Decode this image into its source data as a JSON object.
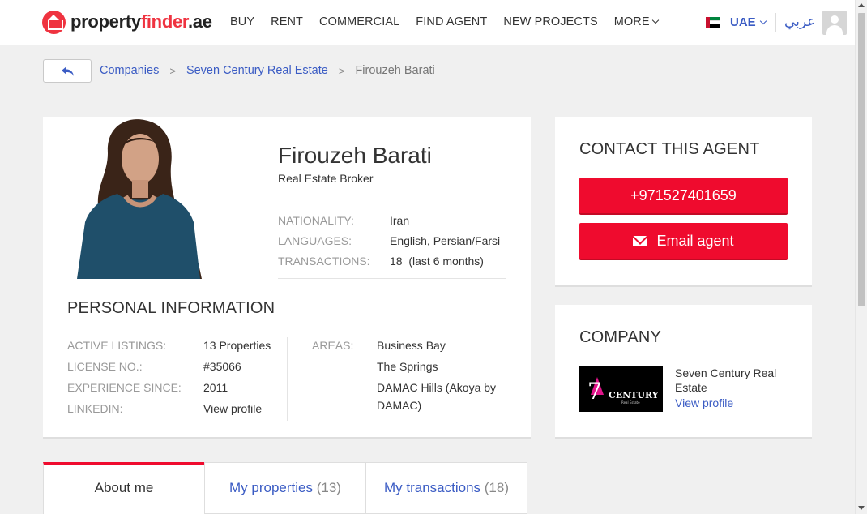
{
  "header": {
    "logo_text_a": "property",
    "logo_text_b": "finder",
    "logo_text_c": ".ae",
    "nav": [
      "BUY",
      "RENT",
      "COMMERCIAL",
      "FIND AGENT",
      "NEW PROJECTS",
      "MORE"
    ],
    "country": "UAE",
    "language_toggle": "عربي"
  },
  "breadcrumb": {
    "items": [
      "Companies",
      "Seven Century Real Estate"
    ],
    "separator": ">",
    "current": "Firouzeh Barati"
  },
  "agent": {
    "name": "Firouzeh Barati",
    "title": "Real Estate Broker",
    "nationality_label": "NATIONALITY:",
    "nationality": "Iran",
    "languages_label": "LANGUAGES:",
    "languages": "English, Persian/Farsi",
    "transactions_label": "TRANSACTIONS:",
    "transactions": "18  (last 6 months)"
  },
  "personal": {
    "heading": "PERSONAL INFORMATION",
    "active_listings_label": "ACTIVE LISTINGS:",
    "active_listings": "13 Properties",
    "license_label": "LICENSE NO.:",
    "license": "#35066",
    "experience_label": "EXPERIENCE SINCE:",
    "experience": "2011",
    "linkedin_label": "LINKEDIN:",
    "linkedin": "View profile",
    "areas_label": "AREAS:",
    "areas": [
      "Business Bay",
      "The Springs",
      "DAMAC Hills (Akoya by",
      "DAMAC)"
    ]
  },
  "contact": {
    "heading": "CONTACT THIS AGENT",
    "phone": "+971527401659",
    "email_label": "Email agent"
  },
  "company": {
    "heading": "COMPANY",
    "name": "Seven Century Real Estate",
    "link": "View profile",
    "logo_numeral": "7",
    "logo_word": "CENTURY",
    "logo_sub": "Real Estate"
  },
  "tabs": [
    {
      "label": "About me",
      "count": ""
    },
    {
      "label": "My properties",
      "count": "(13)"
    },
    {
      "label": "My transactions",
      "count": "(18)"
    }
  ],
  "colors": {
    "accent_red": "#ef0b2e",
    "link_blue": "#3b5cc4",
    "brand_red": "#ef3340"
  }
}
